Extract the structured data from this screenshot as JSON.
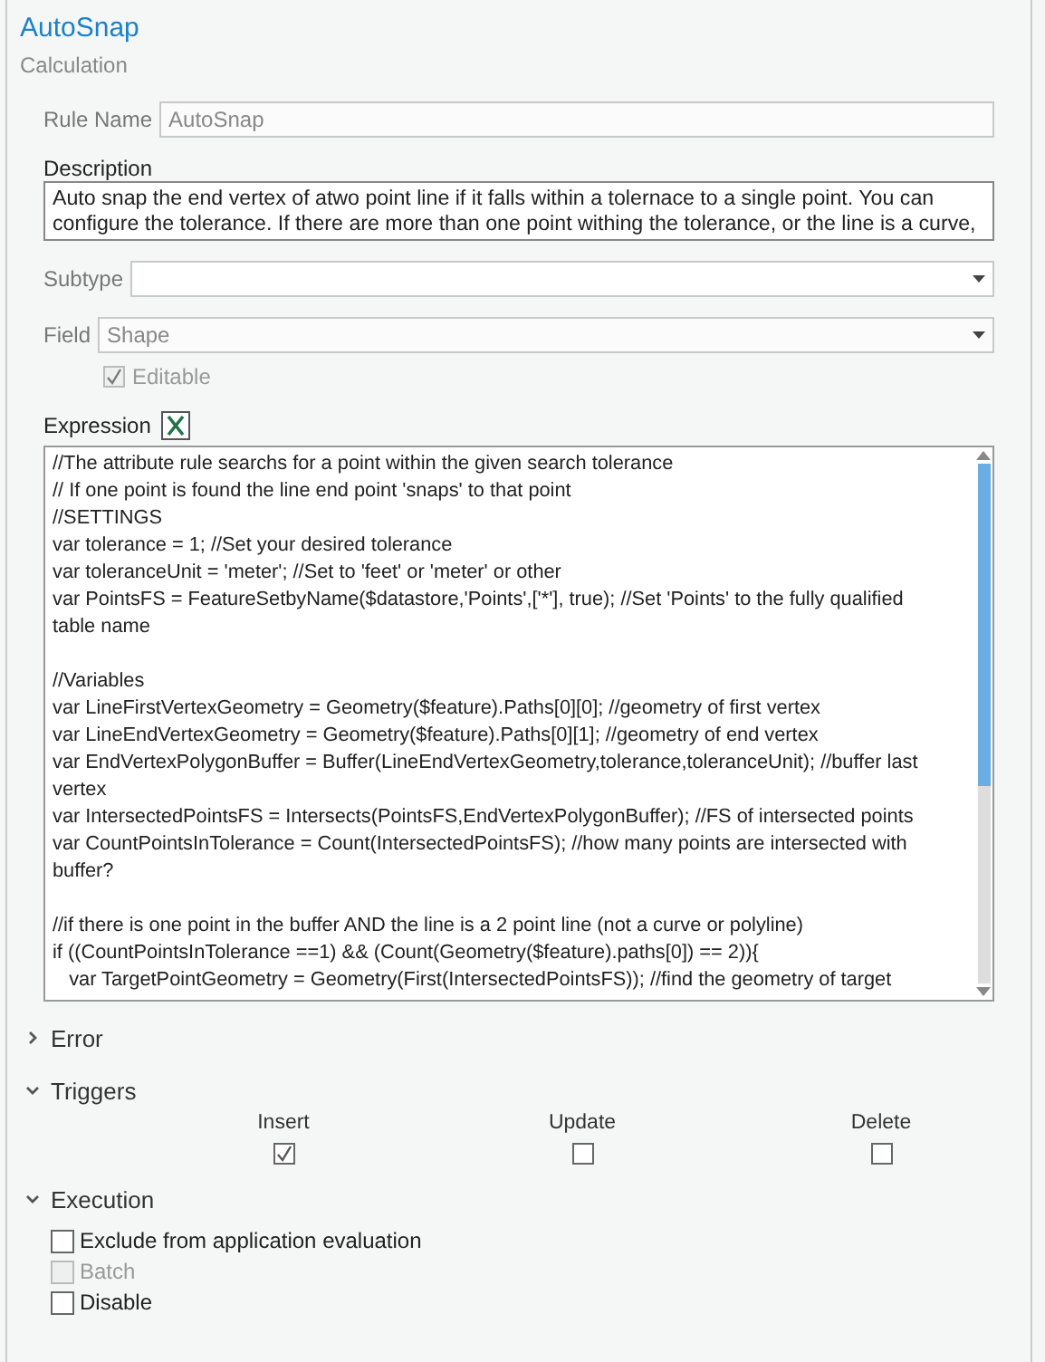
{
  "header": {
    "title": "AutoSnap",
    "subtitle": "Calculation"
  },
  "rule_name": {
    "label": "Rule Name",
    "value": "AutoSnap"
  },
  "description": {
    "label": "Description",
    "lines": [
      "Auto snap the end vertex of atwo point line if it falls within a tolernace to a single point. You can",
      "configure the tolerance. If there are more than one point withing the tolerance, or the line is a curve,"
    ]
  },
  "subtype": {
    "label": "Subtype"
  },
  "field": {
    "label": "Field",
    "value": "Shape"
  },
  "editable": {
    "label": "Editable",
    "checked": true,
    "disabled": true
  },
  "expression": {
    "label": "Expression",
    "paragraphs": [
      [
        "//The attribute rule searchs for a point within the given search tolerance",
        "// If one point is found the line end point 'snaps' to that point",
        "//SETTINGS",
        "var tolerance = 1; //Set your desired tolerance",
        "var toleranceUnit = 'meter'; //Set to 'feet' or 'meter' or other",
        "var PointsFS = FeatureSetbyName($datastore,'Points',['*'], true); //Set 'Points' to the fully qualified",
        "table name"
      ],
      [
        "//Variables",
        "var LineFirstVertexGeometry = Geometry($feature).Paths[0][0]; //geometry of first vertex",
        "var LineEndVertexGeometry = Geometry($feature).Paths[0][1]; //geometry of end vertex",
        "var EndVertexPolygonBuffer = Buffer(LineEndVertexGeometry,tolerance,toleranceUnit); //buffer last",
        "vertex",
        "var IntersectedPointsFS = Intersects(PointsFS,EndVertexPolygonBuffer); //FS of intersected points",
        "var CountPointsInTolerance = Count(IntersectedPointsFS); //how many points are intersected with",
        "buffer?"
      ],
      [
        "//if there is one point in the buffer AND the line is a 2 point line (not a curve or polyline)",
        "if ((CountPointsInTolerance ==1) && (Count(Geometry($feature).paths[0]) == 2)){",
        "   var TargetPointGeometry = Geometry(First(IntersectedPointsFS)); //find the geometry of target"
      ]
    ]
  },
  "sections": [
    {
      "kind": "error",
      "label": "Error",
      "expanded": false
    },
    {
      "kind": "triggers",
      "label": "Triggers",
      "expanded": true,
      "items": [
        {
          "label": "Insert",
          "checked": true
        },
        {
          "label": "Update",
          "checked": false
        },
        {
          "label": "Delete",
          "checked": false
        }
      ]
    },
    {
      "kind": "execution",
      "label": "Execution",
      "expanded": true,
      "items": [
        {
          "label": "Exclude from application evaluation",
          "checked": false,
          "disabled": false
        },
        {
          "label": "Batch",
          "checked": false,
          "disabled": true
        },
        {
          "label": "Disable",
          "checked": false,
          "disabled": false
        }
      ]
    }
  ]
}
